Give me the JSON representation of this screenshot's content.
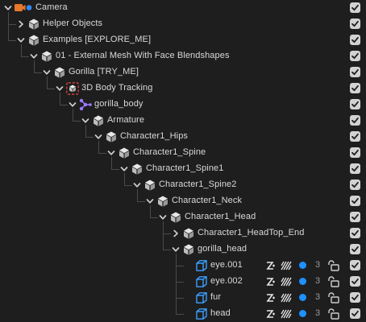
{
  "rows": [
    {
      "label": "Camera",
      "depth": 0,
      "icon": "camera-icon",
      "expanded": true,
      "checked": true
    },
    {
      "label": "Helper Objects",
      "depth": 1,
      "icon": "null-object-icon",
      "expanded": false,
      "checked": true
    },
    {
      "label": "Examples [EXPLORE_ME]",
      "depth": 1,
      "icon": "null-object-icon",
      "expanded": true,
      "checked": true
    },
    {
      "label": "01 - External Mesh With Face Blendshapes",
      "depth": 2,
      "icon": "null-object-icon",
      "expanded": true,
      "checked": true
    },
    {
      "label": "Gorilla [TRY_ME]",
      "depth": 3,
      "icon": "null-object-icon",
      "expanded": true,
      "checked": true
    },
    {
      "label": "3D Body Tracking",
      "depth": 4,
      "icon": "body-tracking-icon",
      "expanded": true,
      "checked": true
    },
    {
      "label": "gorilla_body",
      "depth": 5,
      "icon": "skinned-mesh-icon",
      "expanded": true,
      "checked": true
    },
    {
      "label": "Armature",
      "depth": 6,
      "icon": "null-object-icon",
      "expanded": true,
      "checked": true
    },
    {
      "label": "Character1_Hips",
      "depth": 7,
      "icon": "null-object-icon",
      "expanded": true,
      "checked": true
    },
    {
      "label": "Character1_Spine",
      "depth": 8,
      "icon": "null-object-icon",
      "expanded": true,
      "checked": true
    },
    {
      "label": "Character1_Spine1",
      "depth": 9,
      "icon": "null-object-icon",
      "expanded": true,
      "checked": true
    },
    {
      "label": "Character1_Spine2",
      "depth": 10,
      "icon": "null-object-icon",
      "expanded": true,
      "checked": true
    },
    {
      "label": "Character1_Neck",
      "depth": 11,
      "icon": "null-object-icon",
      "expanded": true,
      "checked": true
    },
    {
      "label": "Character1_Head",
      "depth": 12,
      "icon": "null-object-icon",
      "expanded": true,
      "checked": true
    },
    {
      "label": "Character1_HeadTop_End",
      "depth": 13,
      "icon": "null-object-icon",
      "expanded": false,
      "checked": true
    },
    {
      "label": "gorilla_head",
      "depth": 13,
      "icon": "null-object-icon",
      "expanded": true,
      "checked": true
    },
    {
      "label": "eye.001",
      "depth": 14,
      "icon": "mesh-cube-icon",
      "expanded": null,
      "checked": true,
      "render_order": "3"
    },
    {
      "label": "eye.002",
      "depth": 14,
      "icon": "mesh-cube-icon",
      "expanded": null,
      "checked": true,
      "render_order": "3"
    },
    {
      "label": "fur",
      "depth": 14,
      "icon": "mesh-cube-icon",
      "expanded": null,
      "checked": true,
      "render_order": "3"
    },
    {
      "label": "head",
      "depth": 14,
      "icon": "mesh-cube-icon",
      "expanded": null,
      "checked": true,
      "render_order": "3"
    }
  ],
  "colors": {
    "camera_orange": "#e8782a",
    "camera_dot_blue": "#2d8cff",
    "null_grey": "#cfcfcf",
    "body_tracking_red": "#e0453a",
    "skinned_purple": "#9b7bff",
    "mesh_blue": "#3aa0ff",
    "layer_dot_blue": "#1e90ff",
    "checkbox_bg": "#d2d2d2",
    "checkmark": "#1e1e1e"
  }
}
